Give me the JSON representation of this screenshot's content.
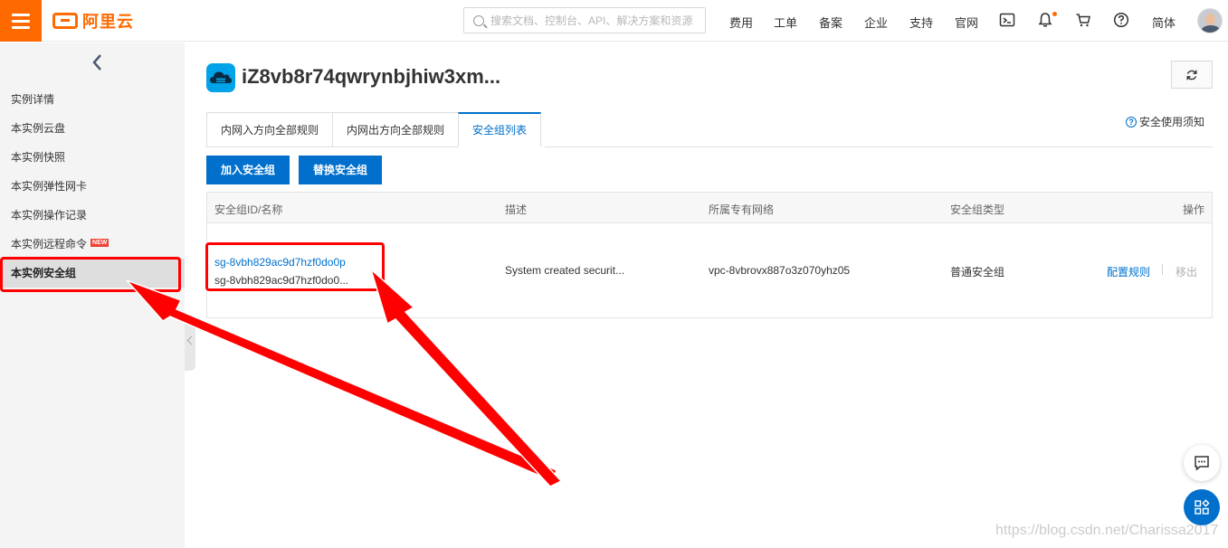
{
  "header": {
    "logo_text": "阿里云",
    "search_placeholder": "搜索文档、控制台、API、解决方案和资源",
    "nav": [
      "费用",
      "工单",
      "备案",
      "企业",
      "支持",
      "官网"
    ],
    "language": "简体",
    "icons": [
      "menu-icon",
      "terminal-icon",
      "bell-icon",
      "cart-icon",
      "help-icon",
      "avatar"
    ]
  },
  "sidebar": {
    "items": [
      {
        "label": "实例详情"
      },
      {
        "label": "本实例云盘"
      },
      {
        "label": "本实例快照"
      },
      {
        "label": "本实例弹性网卡"
      },
      {
        "label": "本实例操作记录"
      },
      {
        "label": "本实例远程命令",
        "badge": "NEW"
      },
      {
        "label": "本实例安全组",
        "active": true
      }
    ]
  },
  "main": {
    "title": "iZ8vb8r74qwrynbjhiw3xm...",
    "tabs": [
      "内网入方向全部规则",
      "内网出方向全部规则",
      "安全组列表"
    ],
    "active_tab": "安全组列表",
    "help_link": "安全使用须知",
    "buttons": {
      "join": "加入安全组",
      "replace": "替换安全组"
    },
    "table": {
      "columns": [
        "安全组ID/名称",
        "描述",
        "所属专有网络",
        "安全组类型",
        "操作"
      ],
      "rows": [
        {
          "id": "sg-8vbh829ac9d7hzf0do0p",
          "name": "sg-8vbh829ac9d7hzf0do0...",
          "description": "System created securit...",
          "vpc": "vpc-8vbrovx887o3z070yhz05",
          "type": "普通安全组",
          "actions": [
            "配置规则",
            "移出"
          ]
        }
      ]
    }
  },
  "watermark": "https://blog.csdn.net/Charissa2017",
  "colors": {
    "brand": "#ff6a00",
    "primary": "#0070cc",
    "annotation": "#ff0000",
    "instance_icon": "#00a3e8"
  }
}
